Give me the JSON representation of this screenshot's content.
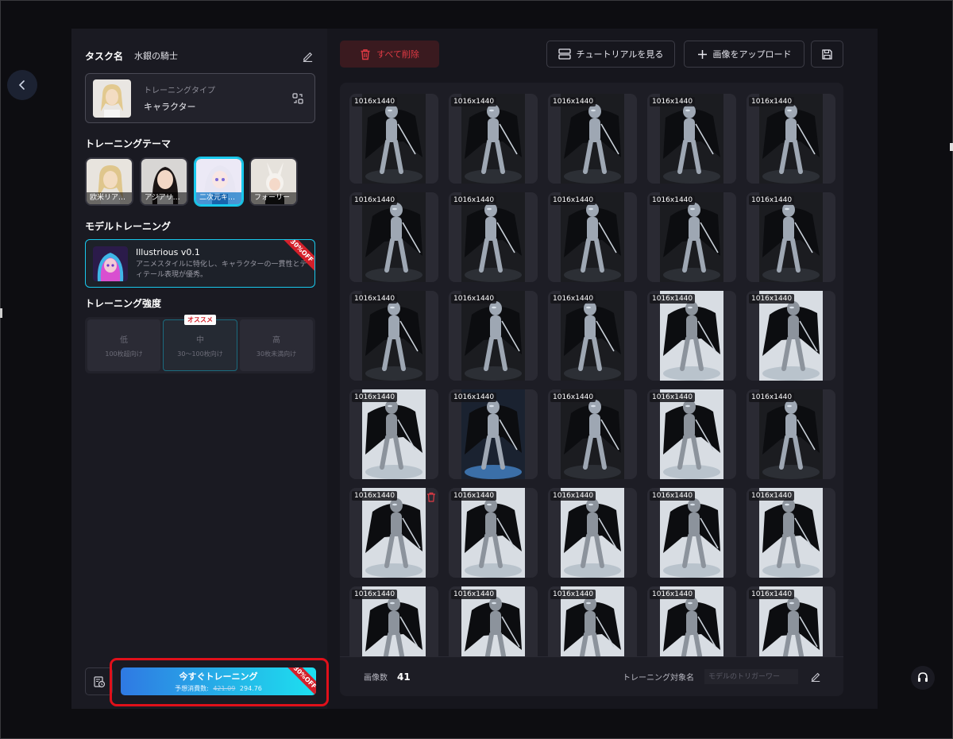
{
  "task": {
    "label": "タスク名",
    "name": "水銀の騎士"
  },
  "training_type": {
    "sublabel": "トレーニングタイプ",
    "value": "キャラクター"
  },
  "theme": {
    "title": "トレーニングテーマ",
    "items": [
      {
        "label": "欧米リア…",
        "active": false
      },
      {
        "label": "アジアリ…",
        "active": false
      },
      {
        "label": "二次元キ…",
        "active": true
      },
      {
        "label": "フォーリー",
        "active": false
      }
    ]
  },
  "model": {
    "title": "モデルトレーニング",
    "name": "Illustrious v0.1",
    "description": "アニメスタイルに特化し、キャラクターの一貫性とディテール表現が優秀。",
    "discount": "30%OFF"
  },
  "strength": {
    "title": "トレーニング強度",
    "recommended_badge": "オススメ",
    "options": [
      {
        "level": "低",
        "desc": "100枚超向け",
        "active": false
      },
      {
        "level": "中",
        "desc": "30～100枚向け",
        "active": true
      },
      {
        "level": "高",
        "desc": "30枚未満向け",
        "active": false
      }
    ]
  },
  "train_button": {
    "label": "今すぐトレーニング",
    "cost_label": "予想消費数:",
    "cost_original": "421.09",
    "cost_discounted": "294.76",
    "discount": "30%OFF"
  },
  "toolbar": {
    "delete_all": "すべて削除",
    "tutorial": "チュートリアルを見る",
    "upload": "画像をアップロード"
  },
  "gallery": {
    "images": [
      {
        "size": "1016x1440",
        "tone": "dark"
      },
      {
        "size": "1016x1440",
        "tone": "dark"
      },
      {
        "size": "1016x1440",
        "tone": "dark"
      },
      {
        "size": "1016x1440",
        "tone": "dark"
      },
      {
        "size": "1016x1440",
        "tone": "dark"
      },
      {
        "size": "1016x1440",
        "tone": "dark"
      },
      {
        "size": "1016x1440",
        "tone": "dark"
      },
      {
        "size": "1016x1440",
        "tone": "dark"
      },
      {
        "size": "1016x1440",
        "tone": "dark"
      },
      {
        "size": "1016x1440",
        "tone": "dark"
      },
      {
        "size": "1016x1440",
        "tone": "dark"
      },
      {
        "size": "1016x1440",
        "tone": "dark"
      },
      {
        "size": "1016x1440",
        "tone": "dark"
      },
      {
        "size": "1016x1440",
        "tone": "light"
      },
      {
        "size": "1016x1440",
        "tone": "light"
      },
      {
        "size": "1016x1440",
        "tone": "light"
      },
      {
        "size": "1016x1440",
        "tone": "blue"
      },
      {
        "size": "1016x1440",
        "tone": "dark"
      },
      {
        "size": "1016x1440",
        "tone": "light"
      },
      {
        "size": "1016x1440",
        "tone": "dark"
      },
      {
        "size": "1016x1440",
        "tone": "light",
        "trash": true
      },
      {
        "size": "1016x1440",
        "tone": "light"
      },
      {
        "size": "1016x1440",
        "tone": "light"
      },
      {
        "size": "1016x1440",
        "tone": "light"
      },
      {
        "size": "1016x1440",
        "tone": "light"
      },
      {
        "size": "1016x1440",
        "tone": "light"
      },
      {
        "size": "1016x1440",
        "tone": "light"
      },
      {
        "size": "1016x1440",
        "tone": "light"
      },
      {
        "size": "1016x1440",
        "tone": "light"
      },
      {
        "size": "1016x1440",
        "tone": "light"
      }
    ]
  },
  "footer": {
    "count_label": "画像数",
    "count": "41",
    "target_label": "トレーニング対象名",
    "trigger_placeholder": "モデルのトリガーワー"
  },
  "colors": {
    "accent": "#19c8ec",
    "danger": "#e03a44",
    "panel": "#1a1a22",
    "highlight": "#e0101a"
  }
}
